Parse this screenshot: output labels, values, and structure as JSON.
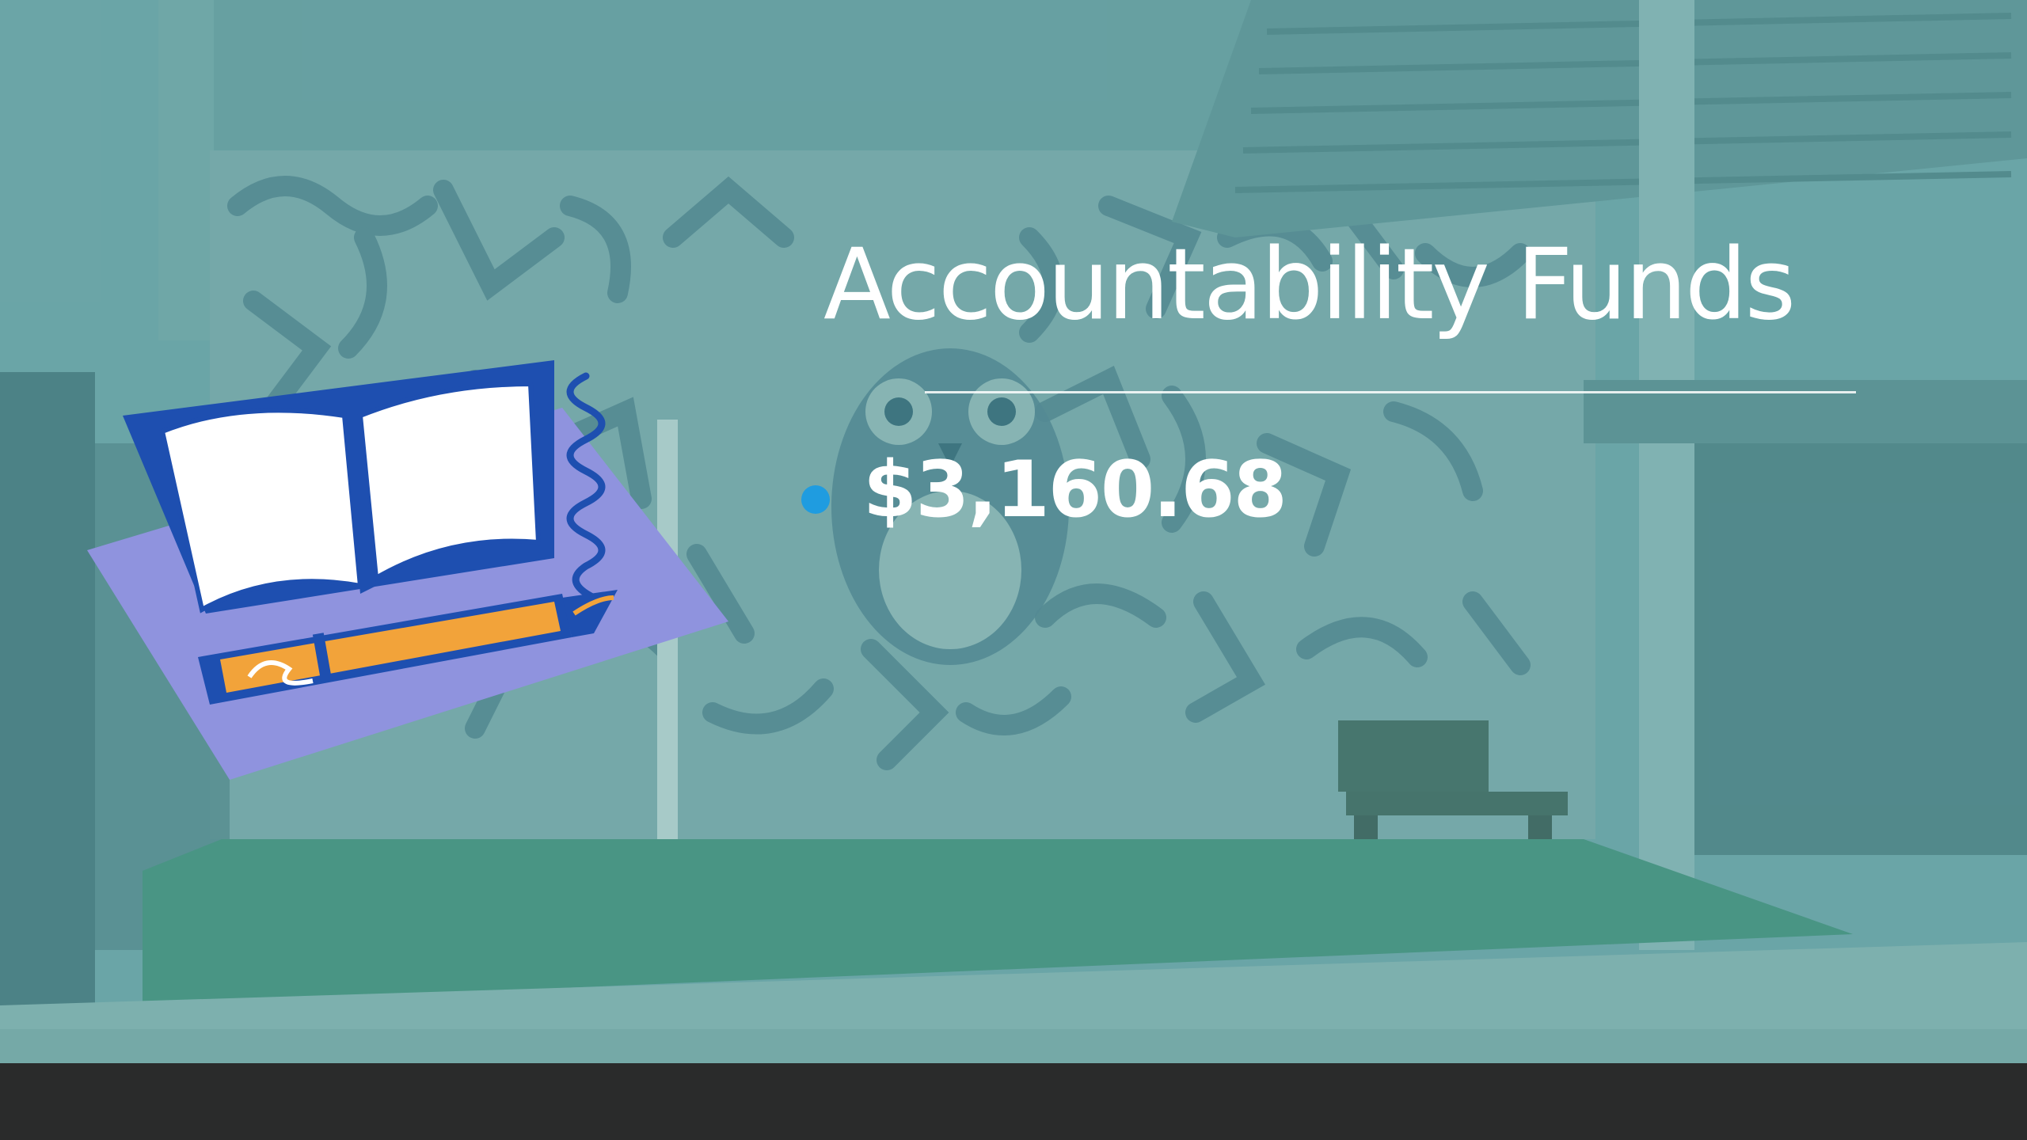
{
  "slide": {
    "title": "Accountability Funds",
    "bullets": [
      {
        "text": "$3,160.68"
      }
    ]
  },
  "icons": {
    "background": "mural-wall-with-owl-background",
    "clipart": "open-book-and-pen-icon",
    "bullet": "bullet-dot-icon"
  },
  "colors": {
    "title_text": "#ffffff",
    "bullet_dot": "#1f9ce0",
    "overlay_tint": "#5fa2a3",
    "bottom_bar": "#2a2b2b",
    "clipart_book_blue": "#1e4fb0",
    "clipart_paper_lavender": "#8f93de",
    "clipart_pen_orange": "#f2a33a"
  }
}
